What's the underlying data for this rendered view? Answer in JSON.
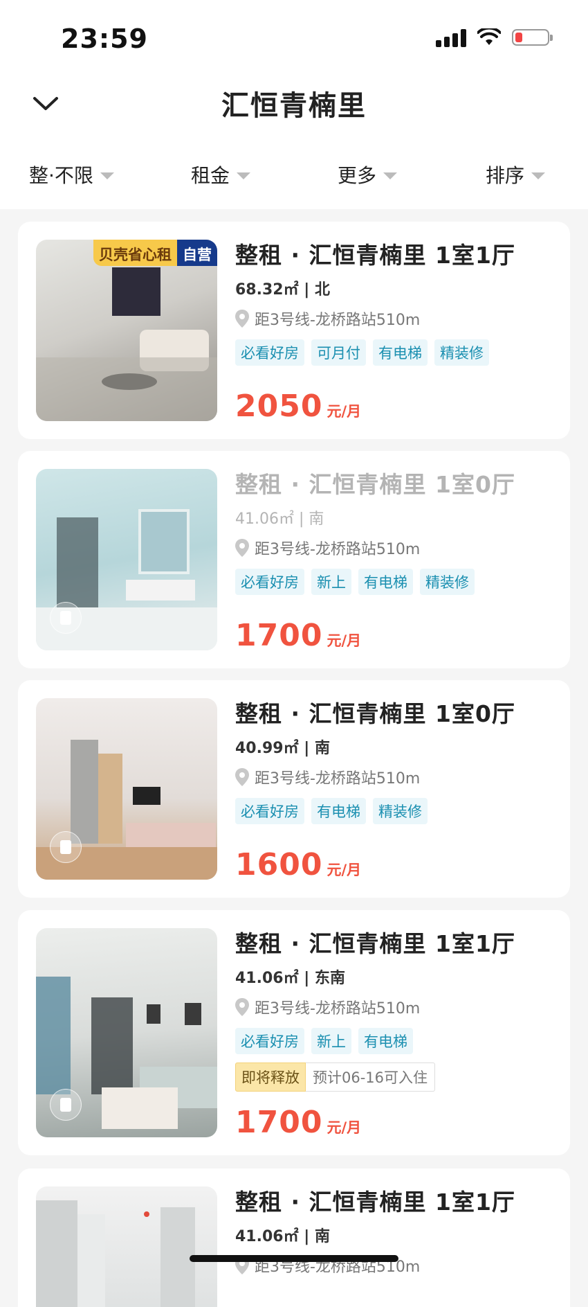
{
  "status": {
    "time": "23:59"
  },
  "header": {
    "title": "汇恒青楠里"
  },
  "filters": [
    "整·不限",
    "租金",
    "更多",
    "排序"
  ],
  "colors": {
    "price": "#f0533f",
    "tag_text": "#1a8fb0",
    "tag_bg": "#eaf6fa"
  },
  "listings": [
    {
      "title": "整租 · 汇恒青楠里 1室1厅",
      "meta": "68.32㎡ | 北",
      "location": "距3号线-龙桥路站510m",
      "tags": [
        "必看好房",
        "可月付",
        "有电梯",
        "精装修"
      ],
      "price": "2050",
      "unit": "元/月",
      "badge": {
        "yellow": "贝壳省心租",
        "blue": "自营"
      },
      "dim": false,
      "thumb_colors": [
        "#d8d8d4",
        "#a5a19b"
      ]
    },
    {
      "title": "整租 · 汇恒青楠里 1室0厅",
      "meta": "41.06㎡ | 南",
      "location": "距3号线-龙桥路站510m",
      "tags": [
        "必看好房",
        "新上",
        "有电梯",
        "精装修"
      ],
      "price": "1700",
      "unit": "元/月",
      "dim": true,
      "thumb_colors": [
        "#bcdcdf",
        "#e6eeee"
      ]
    },
    {
      "title": "整租 · 汇恒青楠里 1室0厅",
      "meta": "40.99㎡ | 南",
      "location": "距3号线-龙桥路站510m",
      "tags": [
        "必看好房",
        "有电梯",
        "精装修"
      ],
      "price": "1600",
      "unit": "元/月",
      "dim": false,
      "thumb_colors": [
        "#e8e4e2",
        "#c9a98d"
      ]
    },
    {
      "title": "整租 · 汇恒青楠里 1室1厅",
      "meta": "41.06㎡ | 东南",
      "location": "距3号线-龙桥路站510m",
      "tags": [
        "必看好房",
        "新上",
        "有电梯"
      ],
      "release": {
        "label": "即将释放",
        "note": "预计06-16可入住"
      },
      "price": "1700",
      "unit": "元/月",
      "dim": false,
      "thumb_colors": [
        "#dfe3e2",
        "#9aa6a3"
      ]
    },
    {
      "title": "整租 · 汇恒青楠里 1室1厅",
      "meta": "41.06㎡ | 南",
      "location": "距3号线-龙桥路站510m",
      "tags": [],
      "dim": false,
      "thumb_colors": [
        "#e4e6e6",
        "#cfd3d3"
      ]
    }
  ]
}
